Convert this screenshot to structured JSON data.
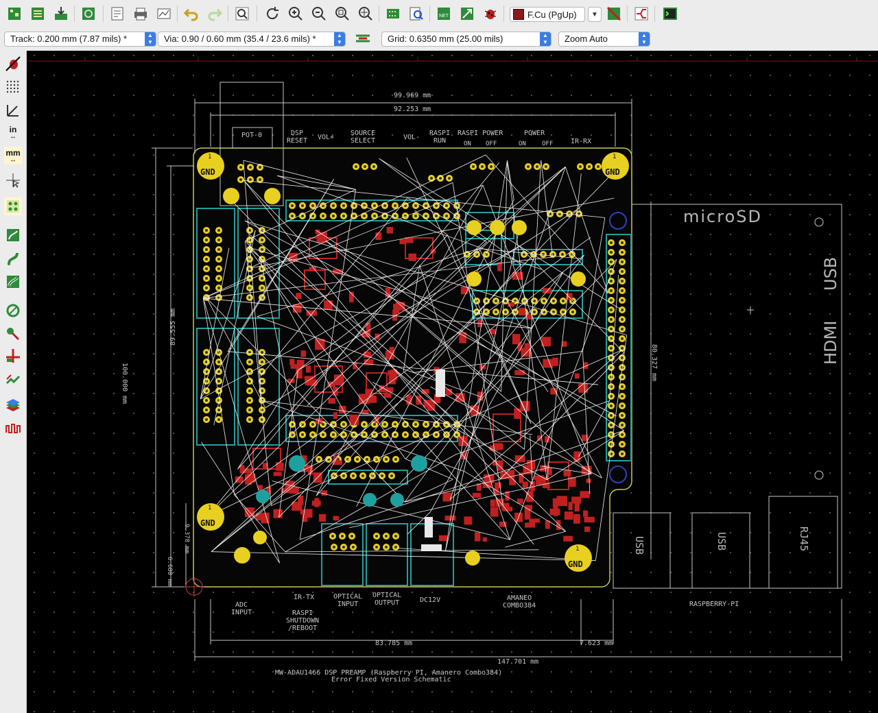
{
  "toolbar": {
    "layer": "F.Cu (PgUp)",
    "colors": {
      "fcu": "#8b1a1a",
      "accent": "#3b7de3"
    }
  },
  "toolbar2": {
    "track": "Track: 0.200 mm (7.87 mils) *",
    "via": "Via: 0.90 / 0.60 mm (35.4 / 23.6 mils) *",
    "grid": "Grid: 0.6350 mm (25.00 mils)",
    "zoom": "Zoom Auto"
  },
  "left_toolbar": {
    "inch_label": "in",
    "mm_label": "mm"
  },
  "board": {
    "dims": {
      "top_outer": "99.969 mm",
      "top_inner": "92.253 mm",
      "left_outer": "100.000 mm",
      "left_inner": "89.555 mm",
      "right": "80.327 mm",
      "bottom_inner": "83.785 mm",
      "bottom_small": "7.623 mm",
      "bottom_outer": "147.701 mm",
      "small_a": "9.378 mm",
      "small_b": "6.680 mm"
    },
    "labels": {
      "pot": "POT-0",
      "dsp_reset": "DSP\nRESET",
      "vol_plus": "VOL+",
      "source_select": "SOURCE\nSELECT",
      "vol_minus": "VOL-",
      "raspi_run": "RASPI\nRUN",
      "raspi_power": "RASPI POWER",
      "raspi_power_on": "ON",
      "raspi_power_off": "OFF",
      "power": "POWER",
      "power_on": "ON",
      "power_off": "OFF",
      "ir_rx": "IR-RX",
      "gnd": "GND",
      "one": "1",
      "microsd": "microSD",
      "usb": "USB",
      "hdmi": "HDMI",
      "rj45": "RJ45",
      "raspberry_pi": "RASPBERRY-PI",
      "adc_input": "ADC\nINPUT",
      "ir_tx": "IR-TX",
      "raspi_shutdown": "RASPI\nSHUTDOWN\n/REBOOT",
      "optical_input": "OPTICAL\nINPUT",
      "optical_output": "OPTICAL\nOUTPUT",
      "dc12v": "DC12V",
      "amaneo": "AMANEO\nCOMBO384",
      "title_line1": "MW-ADAU1466 DSP PREAMP (Raspberry PI, Amanero Combo384)",
      "title_line2": "Error Fixed Version Schematic"
    }
  }
}
